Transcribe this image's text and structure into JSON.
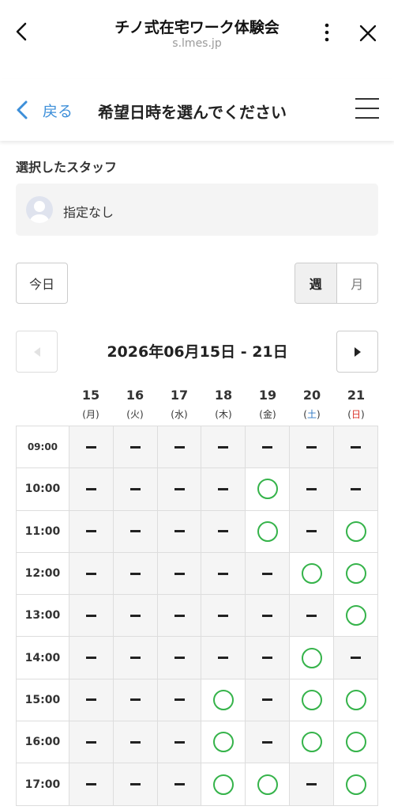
{
  "browser": {
    "title": "チノ式在宅ワーク体験会",
    "url": "s.lmes.jp"
  },
  "header": {
    "back_label": "戻る",
    "title": "希望日時を選んでください"
  },
  "staff": {
    "heading": "選択したスタッフ",
    "name": "指定なし"
  },
  "controls": {
    "today_label": "今日",
    "week_label": "週",
    "month_label": "月",
    "selected_view": "week",
    "range_label": "2026年06月15日 - 21日"
  },
  "colors": {
    "accent_blue": "#3d8fd9",
    "available_green": "#35b34a",
    "saturday_blue": "#2f78c4",
    "sunday_red": "#d9342b"
  },
  "days": [
    {
      "num": "15",
      "weekday": "月",
      "type": "weekday"
    },
    {
      "num": "16",
      "weekday": "火",
      "type": "weekday"
    },
    {
      "num": "17",
      "weekday": "水",
      "type": "weekday"
    },
    {
      "num": "18",
      "weekday": "木",
      "type": "weekday"
    },
    {
      "num": "19",
      "weekday": "金",
      "type": "weekday"
    },
    {
      "num": "20",
      "weekday": "土",
      "type": "sat"
    },
    {
      "num": "21",
      "weekday": "日",
      "type": "sun"
    }
  ],
  "slots": [
    {
      "time": "09:00",
      "availability": [
        false,
        false,
        false,
        false,
        false,
        false,
        false
      ]
    },
    {
      "time": "10:00",
      "availability": [
        false,
        false,
        false,
        false,
        true,
        false,
        false
      ]
    },
    {
      "time": "11:00",
      "availability": [
        false,
        false,
        false,
        false,
        true,
        false,
        true
      ]
    },
    {
      "time": "12:00",
      "availability": [
        false,
        false,
        false,
        false,
        false,
        true,
        true
      ]
    },
    {
      "time": "13:00",
      "availability": [
        false,
        false,
        false,
        false,
        false,
        false,
        true
      ]
    },
    {
      "time": "14:00",
      "availability": [
        false,
        false,
        false,
        false,
        false,
        true,
        false
      ]
    },
    {
      "time": "15:00",
      "availability": [
        false,
        false,
        false,
        true,
        false,
        true,
        true
      ]
    },
    {
      "time": "16:00",
      "availability": [
        false,
        false,
        false,
        true,
        false,
        true,
        true
      ]
    },
    {
      "time": "17:00",
      "availability": [
        false,
        false,
        false,
        true,
        true,
        false,
        true
      ]
    }
  ]
}
